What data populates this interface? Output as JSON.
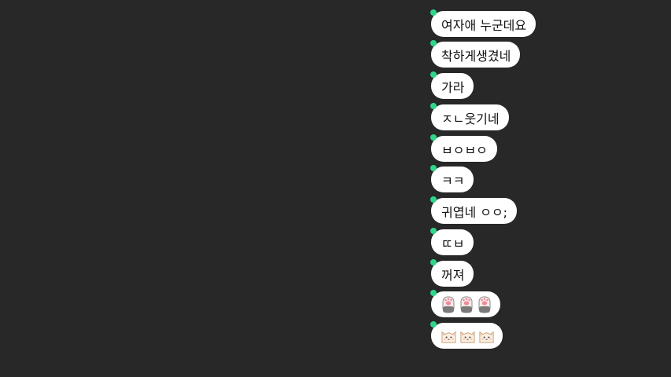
{
  "messages": [
    {
      "type": "text",
      "text": "여자애 누군데요"
    },
    {
      "type": "text",
      "text": "착하게생겼네"
    },
    {
      "type": "text",
      "text": "가라"
    },
    {
      "type": "text",
      "text": "ㅈㄴ웃기네"
    },
    {
      "type": "text",
      "text": "ㅂㅇㅂㅇ"
    },
    {
      "type": "text",
      "text": "ㅋㅋ"
    },
    {
      "type": "text",
      "text": "귀엽네 ㅇㅇ;"
    },
    {
      "type": "text",
      "text": "ㄸㅂ"
    },
    {
      "type": "text",
      "text": "꺼져"
    },
    {
      "type": "emoji",
      "emoji": "cat-paw-emoji",
      "count": 3
    },
    {
      "type": "emoji",
      "emoji": "cat-face-emoji",
      "count": 3
    }
  ],
  "colors": {
    "background": "#282828",
    "bubble": "#ffffff",
    "unread_dot": "#2fd68a"
  }
}
